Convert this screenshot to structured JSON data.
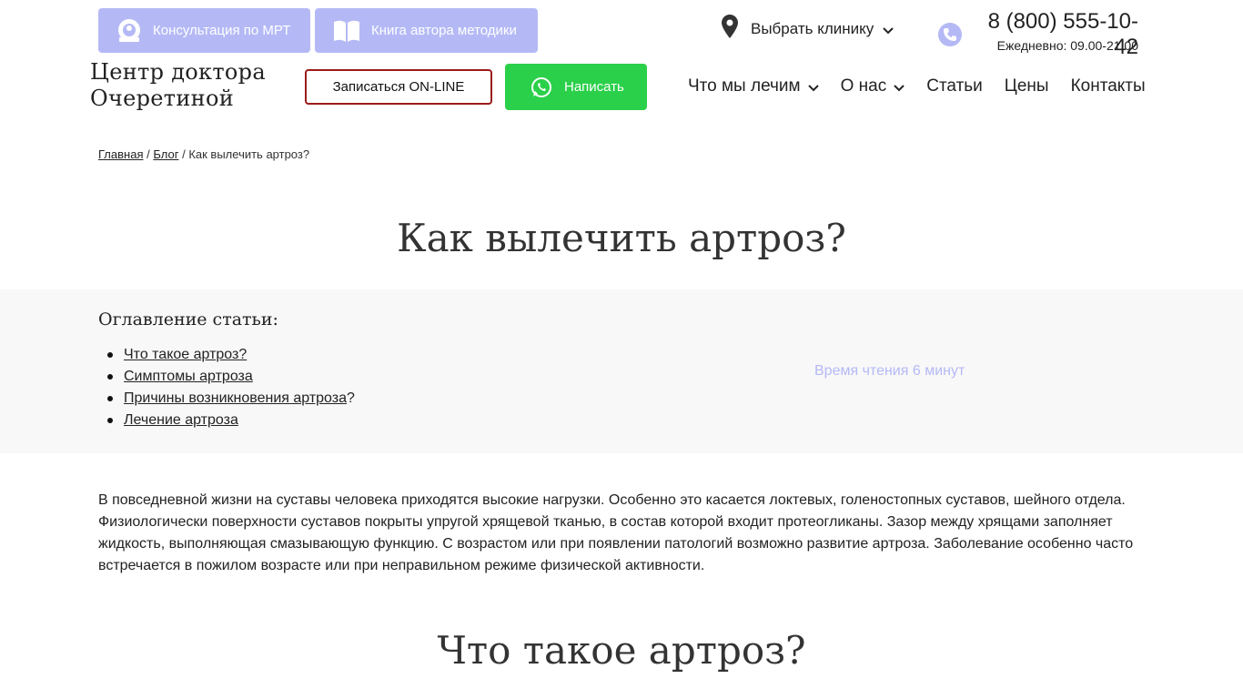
{
  "header": {
    "mri_button": "Консультация по МРТ",
    "book_button": "Книга автора методики",
    "clinic_select": "Выбрать клинику",
    "phone": "8 (800) 555-10-42",
    "hours": "Ежедневно: 09.00-21.00",
    "logo_line1": "Центр доктора",
    "logo_line2": "Очеретиной",
    "online_button": "Записаться ON-LINE",
    "write_button": "Написать",
    "nav": [
      {
        "label": "Что мы лечим"
      },
      {
        "label": "О нас"
      },
      {
        "label": "Статьи"
      },
      {
        "label": "Цены"
      },
      {
        "label": "Контакты"
      }
    ]
  },
  "breadcrumb": {
    "home": "Главная",
    "sep": "/",
    "blog": "Блог",
    "current": "Как вылечить артроз?"
  },
  "page_title": "Как вылечить артроз?",
  "toc": {
    "title": "Оглавление статьи:",
    "items": [
      {
        "label": "Что такое артроз?",
        "suffix": ""
      },
      {
        "label": "Симптомы артроза",
        "suffix": ""
      },
      {
        "label": "Причины возникновения артроза",
        "suffix": "?"
      },
      {
        "label": "Лечение артроза",
        "suffix": ""
      }
    ],
    "reading_time": "Время чтения 6 минут"
  },
  "intro": "В повседневной жизни на суставы человека приходятся высокие нагрузки. Особенно это касается локтевых, голеностопных суставов, шейного отдела. Физиологически поверхности суставов покрыты упругой хрящевой тканью, в состав которой входит протеогликаны. Зазор между хрящами заполняет жидкость, выполняющая смазывающую функцию. С возрастом или при появлении патологий возможно развитие артроза. Заболевание особенно часто встречается в пожилом возрасте или при неправильном режиме физической активности.",
  "section_title": "Что такое артроз?",
  "colors": {
    "accent": "#b4b9f6",
    "whatsapp": "#2bd04a",
    "online_border": "#9b1b1b"
  }
}
